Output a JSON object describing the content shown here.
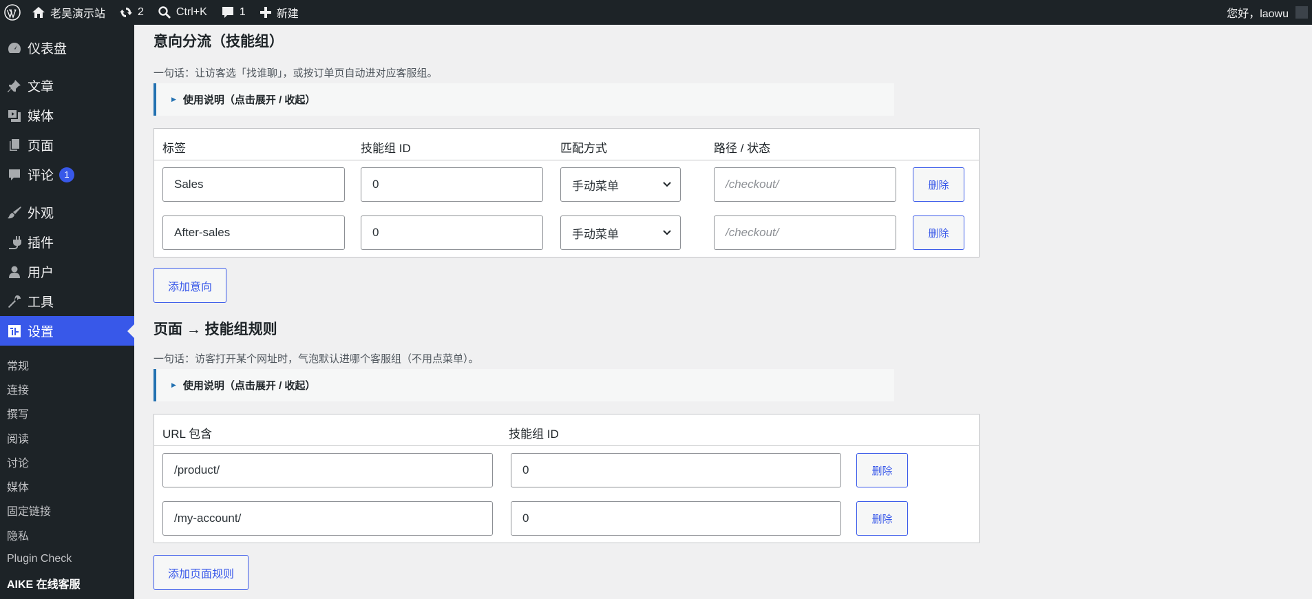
{
  "admin_bar": {
    "site_name": "老吴演示站",
    "updates_count": "2",
    "search_shortcut": "Ctrl+K",
    "comments_count": "1",
    "new_label": "新建",
    "greeting": "您好，laowu"
  },
  "sidebar": {
    "items": [
      {
        "label": "仪表盘",
        "icon": "dashboard-icon"
      },
      {
        "label": "文章",
        "icon": "pin-icon"
      },
      {
        "label": "媒体",
        "icon": "media-icon"
      },
      {
        "label": "页面",
        "icon": "page-icon"
      },
      {
        "label": "评论",
        "icon": "comment-icon",
        "badge": "1"
      },
      {
        "label": "外观",
        "icon": "brush-icon"
      },
      {
        "label": "插件",
        "icon": "plug-icon"
      },
      {
        "label": "用户",
        "icon": "user-icon"
      },
      {
        "label": "工具",
        "icon": "wrench-icon"
      },
      {
        "label": "设置",
        "icon": "settings-icon"
      }
    ],
    "submenu": [
      "常规",
      "连接",
      "撰写",
      "阅读",
      "讨论",
      "媒体",
      "固定链接",
      "隐私",
      "Plugin Check",
      "AIKE 在线客服"
    ]
  },
  "intent": {
    "title": "意向分流（技能组）",
    "desc": "一句话：让访客选「找谁聊」，或按订单页自动进对应客服组。",
    "help_toggle": "使用说明（点击展开 / 收起）",
    "columns": [
      "标签",
      "技能组 ID",
      "匹配方式",
      "路径 / 状态"
    ],
    "rows": [
      {
        "label": "Sales",
        "group_id": "0",
        "match": "手动菜单",
        "path_placeholder": "/checkout/",
        "delete": "删除"
      },
      {
        "label": "After-sales",
        "group_id": "0",
        "match": "手动菜单",
        "path_placeholder": "/checkout/",
        "delete": "删除"
      }
    ],
    "add_button": "添加意向"
  },
  "page_rules": {
    "title": "页面 → 技能组规则",
    "desc": "一句话：访客打开某个网址时，气泡默认进哪个客服组（不用点菜单）。",
    "help_toggle": "使用说明（点击展开 / 收起）",
    "columns": [
      "URL 包含",
      "技能组 ID"
    ],
    "rows": [
      {
        "url": "/product/",
        "group_id": "0",
        "delete": "删除"
      },
      {
        "url": "/my-account/",
        "group_id": "0",
        "delete": "删除"
      }
    ],
    "add_button": "添加页面规则"
  },
  "colors": {
    "admin_bg": "#1d2327",
    "accent": "#3858e9",
    "notice_border": "#2271b1"
  }
}
